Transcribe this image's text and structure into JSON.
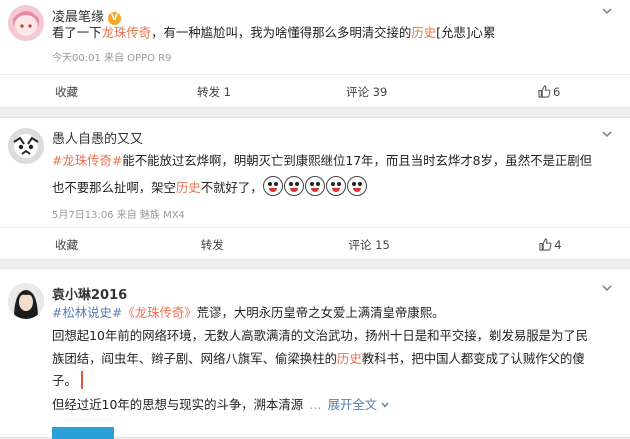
{
  "posts": [
    {
      "username": "凌晨笔缘",
      "badge": "V",
      "line1_pre": "看了一下",
      "line1_link": "龙珠传奇",
      "line1_mid": "，有一种尴尬叫，我为啥懂得那么多明清交接的",
      "line1_link2": "历史",
      "line1_post": "[允悲]心累",
      "meta": "今天00:01 来自 OPPO R9",
      "actions": {
        "favorite": "收藏",
        "repost": "转发 1",
        "comment": "评论 39",
        "like": "6"
      }
    },
    {
      "username": "愚人自愚的又又",
      "line1_tag": "#龙珠传奇#",
      "line1_text": "能不能放过玄烨啊，明朝灭亡到康熙继位17年，而且当时玄烨才8岁，虽然不是正剧但",
      "line2_pre": "也不要那么扯啊，架空",
      "line2_link": "历史",
      "line2_post": "不就好了，",
      "meta": "5月7日13:06 来自 魅族 MX4",
      "actions": {
        "favorite": "收藏",
        "repost": "转发",
        "comment": "评论 15",
        "like": "4"
      }
    },
    {
      "username": "袁小琳2016",
      "line1_tag": "#松林说史#",
      "line1_link": "《龙珠传奇》",
      "line1_text": "荒谬，大明永历皇帝之女爱上满清皇帝康熙。",
      "line2": "回想起10年前的网络环境，无数人高歌满清的文治武功，扬州十日是和平交接，剃发易服是为了民",
      "line3_pre": "族团结，阎虫年、辫子剧、网络八旗军、偷梁换柱的",
      "line3_link": "历史",
      "line3_post": "教科书，把中国人都变成了认贼作父的傻",
      "line4": "子。",
      "line5_pre": "但经过近10年的思想与现实的斗争，溯本清源",
      "line5_more": "展开全文"
    }
  ],
  "colors": {
    "link": "#eb7350",
    "tag": "#5b7db1",
    "badge": "#f5a623"
  }
}
